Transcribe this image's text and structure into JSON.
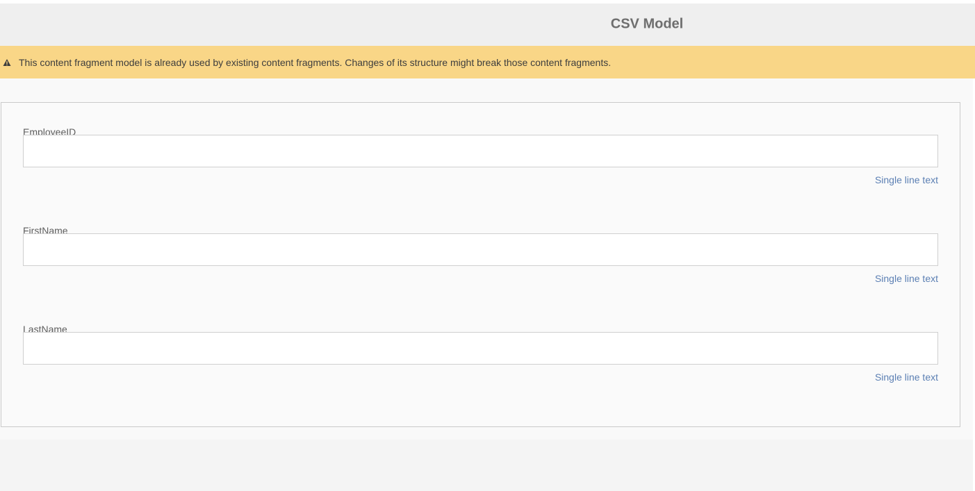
{
  "header": {
    "title": "CSV Model"
  },
  "alert": {
    "icon": "warning-icon",
    "message": "This content fragment model is already used by existing content fragments. Changes of its structure might break those content fragments."
  },
  "fields": [
    {
      "label": "EmployeeID",
      "value": "",
      "type_label": "Single line text"
    },
    {
      "label": "FirstName",
      "value": "",
      "type_label": "Single line text"
    },
    {
      "label": "LastName",
      "value": "",
      "type_label": "Single line text"
    }
  ],
  "colors": {
    "alert_background": "#f9d687",
    "type_link": "#5b7fb3"
  }
}
